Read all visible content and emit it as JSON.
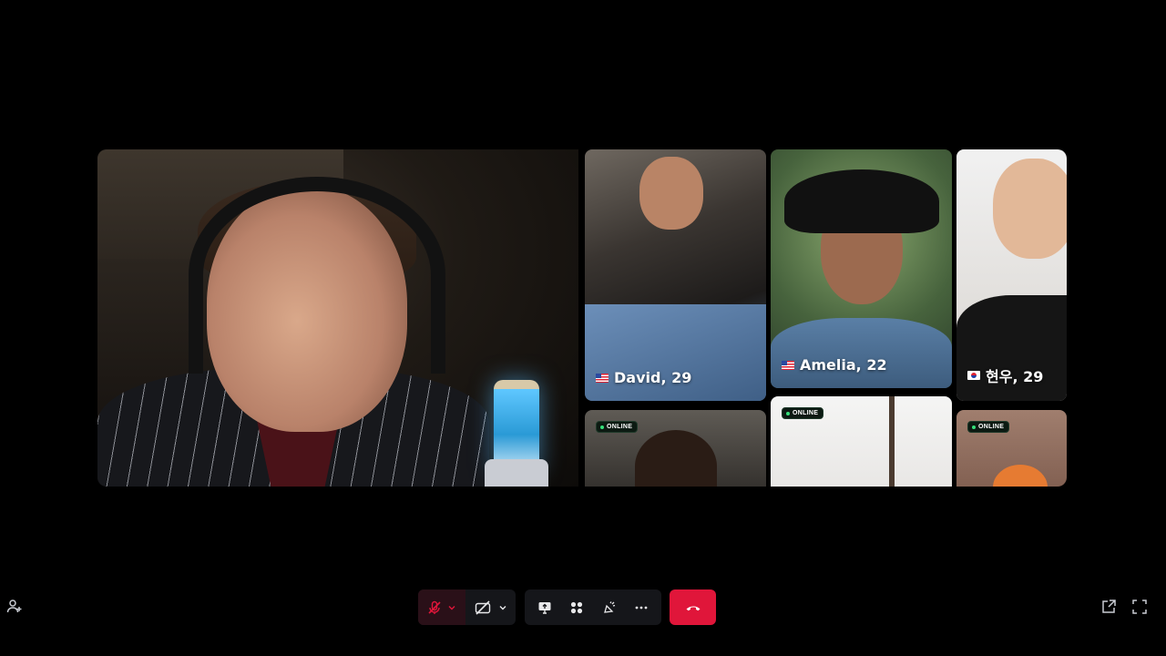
{
  "participants": [
    {
      "name_age": "David, 29",
      "flag": "us"
    },
    {
      "name_age": "Amelia, 22",
      "flag": "us"
    },
    {
      "name_age": "현우, 29",
      "flag": "kr"
    }
  ],
  "online_badges": [
    "ONLINE",
    "ONLINE",
    "ONLINE"
  ],
  "toolbar": {
    "mic": {
      "icon": "mic-off-icon",
      "state": "muted"
    },
    "camera": {
      "icon": "camera-off-icon",
      "state": "off"
    },
    "share": {
      "icon": "screen-share-icon"
    },
    "layout": {
      "icon": "grid-layout-icon"
    },
    "effects": {
      "icon": "reactions-icon"
    },
    "more": {
      "icon": "more-icon"
    },
    "end_call": {
      "icon": "hang-up-icon",
      "color": "#e0163a"
    }
  },
  "colors": {
    "background": "#000000",
    "accent_red": "#e0163a",
    "online_green": "#36e07a"
  }
}
